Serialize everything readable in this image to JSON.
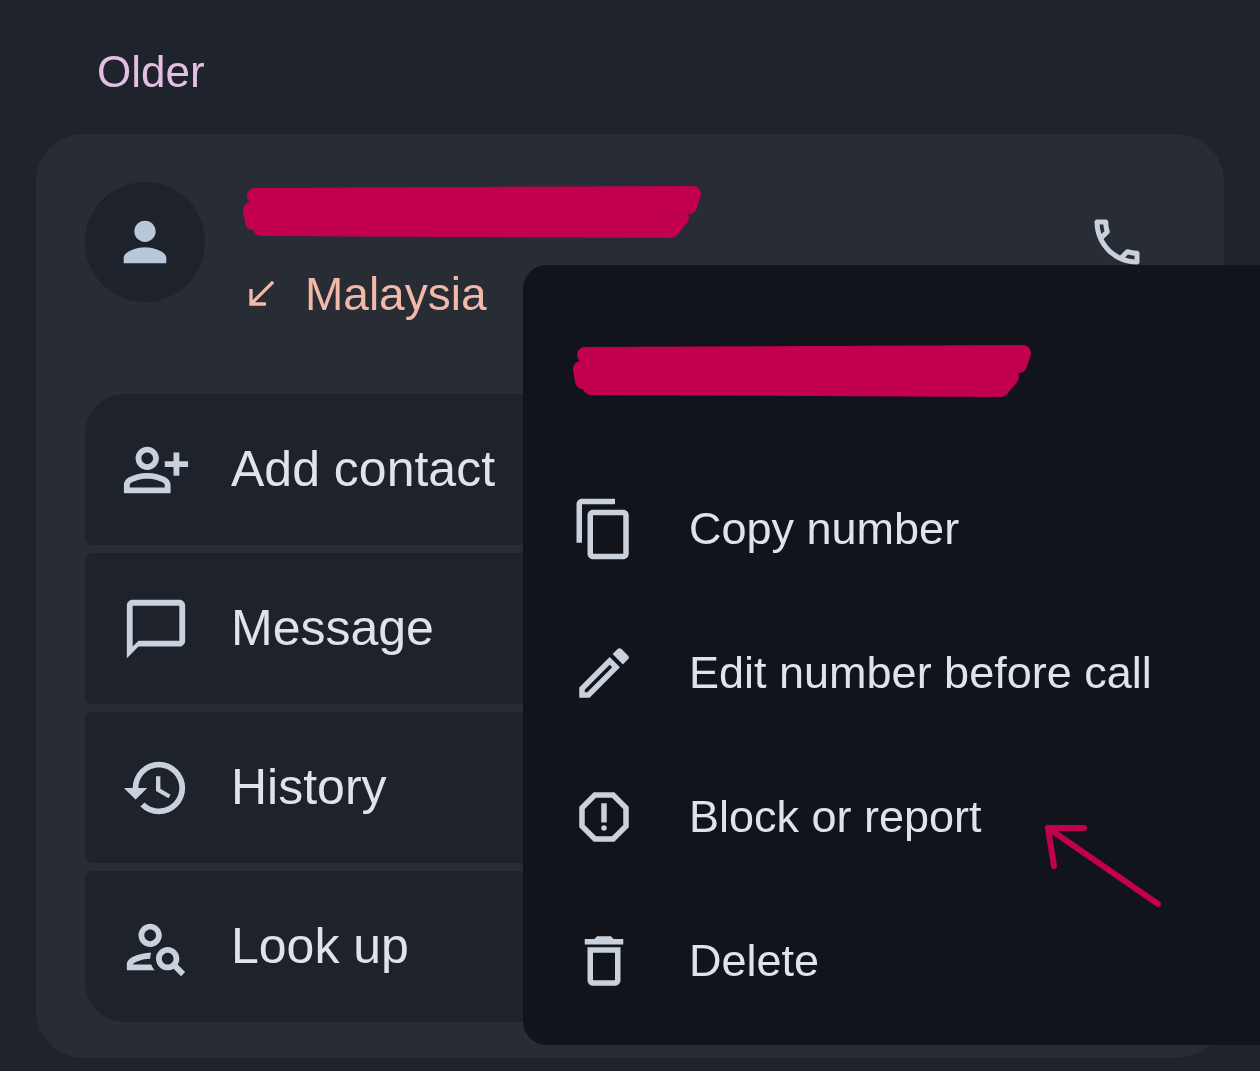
{
  "section_header": "Older",
  "entry": {
    "country": "Malaysia"
  },
  "actions": [
    {
      "label": "Add contact"
    },
    {
      "label": "Message"
    },
    {
      "label": "History"
    },
    {
      "label": "Look up"
    }
  ],
  "menu": {
    "items": [
      {
        "label": "Copy number"
      },
      {
        "label": "Edit number before call"
      },
      {
        "label": "Block or report"
      },
      {
        "label": "Delete"
      }
    ]
  }
}
